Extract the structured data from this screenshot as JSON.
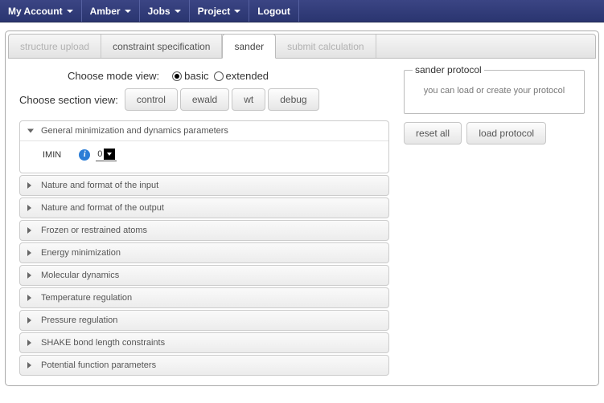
{
  "nav": {
    "items": [
      {
        "label": "My Account",
        "caret": true
      },
      {
        "label": "Amber",
        "caret": true
      },
      {
        "label": "Jobs",
        "caret": true
      },
      {
        "label": "Project",
        "caret": true
      },
      {
        "label": "Logout",
        "caret": false
      }
    ]
  },
  "tabs": [
    {
      "label": "structure upload",
      "state": "disabled"
    },
    {
      "label": "constraint specification",
      "state": "normal"
    },
    {
      "label": "sander",
      "state": "active"
    },
    {
      "label": "submit calculation",
      "state": "disabled"
    }
  ],
  "mode_view": {
    "label": "Choose mode view:",
    "options": [
      {
        "label": "basic",
        "checked": true
      },
      {
        "label": "extended",
        "checked": false
      }
    ]
  },
  "section_view": {
    "label": "Choose section view:",
    "buttons": [
      "control",
      "ewald",
      "wt",
      "debug"
    ]
  },
  "accordion": [
    {
      "title": "General minimization and dynamics parameters",
      "open": true,
      "params": [
        {
          "name": "IMIN",
          "value": "0"
        }
      ]
    },
    {
      "title": "Nature and format of the input",
      "open": false
    },
    {
      "title": "Nature and format of the output",
      "open": false
    },
    {
      "title": "Frozen or restrained atoms",
      "open": false
    },
    {
      "title": "Energy minimization",
      "open": false
    },
    {
      "title": "Molecular dynamics",
      "open": false
    },
    {
      "title": "Temperature regulation",
      "open": false
    },
    {
      "title": "Pressure regulation",
      "open": false
    },
    {
      "title": "SHAKE bond length constraints",
      "open": false
    },
    {
      "title": "Potential function parameters",
      "open": false
    }
  ],
  "protocol": {
    "legend": "sander protocol",
    "message": "you can load or create your protocol",
    "reset_btn": "reset all",
    "load_btn": "load protocol"
  }
}
